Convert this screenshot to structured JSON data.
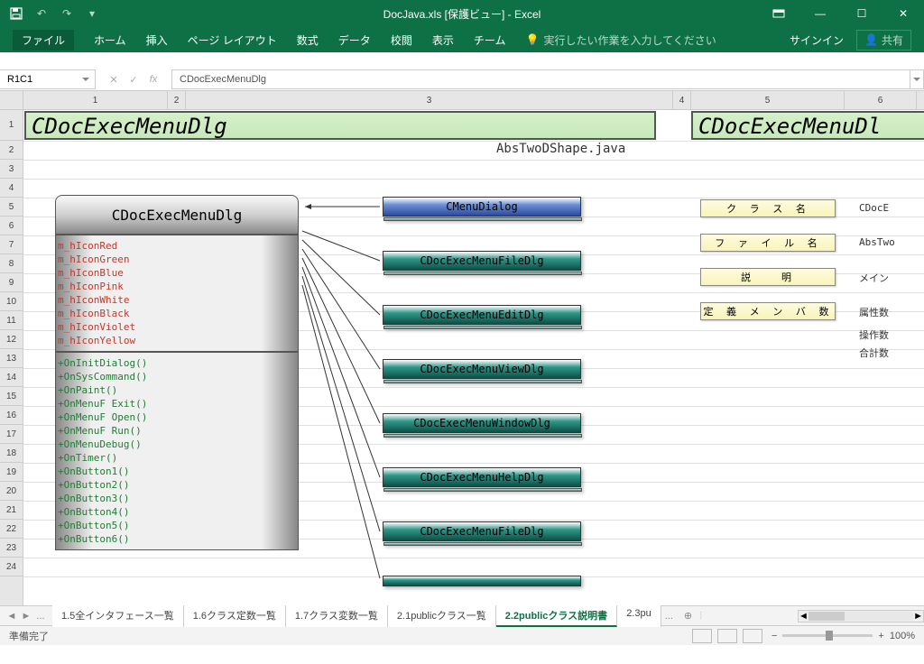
{
  "title": "DocJava.xls  [保護ビュー] - Excel",
  "ribbon": {
    "file": "ファイル",
    "home": "ホーム",
    "insert": "挿入",
    "layout": "ページ レイアウト",
    "formula": "数式",
    "data": "データ",
    "review": "校閲",
    "view": "表示",
    "team": "チーム",
    "tellme": "実行したい作業を入力してください",
    "signin": "サインイン",
    "share": "共有"
  },
  "namebox": "R1C1",
  "formula": "CDocExecMenuDlg",
  "colheads": [
    "1",
    "2",
    "3",
    "4",
    "5",
    "6"
  ],
  "rowheads": [
    "1",
    "2",
    "3",
    "4",
    "5",
    "6",
    "7",
    "8",
    "9",
    "10",
    "11",
    "12",
    "13",
    "14",
    "15",
    "16",
    "17",
    "18",
    "19",
    "20",
    "21",
    "22",
    "23",
    "24"
  ],
  "banner1": "CDocExecMenuDlg",
  "banner2": "CDocExecMenuDl",
  "filelabel": "AbsTwoDShape.java",
  "classname": "CDocExecMenuDlg",
  "attrs": [
    "m_hIconRed",
    "m_hIconGreen",
    "m_hIconBlue",
    "m_hIconPink",
    "m_hIconWhite",
    "m_hIconBlack",
    "m_hIconViolet",
    "m_hIconYellow"
  ],
  "methods": [
    "+OnInitDialog()",
    "+OnSysCommand()",
    "+OnPaint()",
    "+OnMenuF Exit()",
    "+OnMenuF Open()",
    "+OnMenuF Run()",
    "+OnMenuDebug()",
    "+OnTimer()",
    "+OnButton1()",
    "+OnButton2()",
    "+OnButton3()",
    "+OnButton4()",
    "+OnButton5()",
    "+OnButton6()"
  ],
  "relboxes": [
    "CMenuDialog",
    "CDocExecMenuFileDlg",
    "CDocExecMenuEditDlg",
    "CDocExecMenuViewDlg",
    "CDocExecMenuWindowDlg",
    "CDocExecMenuHelpDlg",
    "CDocExecMenuFileDlg"
  ],
  "props": [
    {
      "label": "ク ラ ス 名",
      "val": "CDocE"
    },
    {
      "label": "フ ァ イ ル 名",
      "val": "AbsTwo"
    },
    {
      "label": "説　　明",
      "val": "メイン"
    },
    {
      "label": "定 義 メ ン バ 数",
      "val": "属性数"
    }
  ],
  "extravals": [
    "操作数",
    "合計数"
  ],
  "tabs": [
    "1.5全インタフェース一覧",
    "1.6クラス定数一覧",
    "1.7クラス変数一覧",
    "2.1publicクラス一覧",
    "2.2publicクラス説明書",
    "2.3pu"
  ],
  "activeTab": "2.2publicクラス説明書",
  "tabmore": "...",
  "status": "準備完了",
  "zoom": "100%"
}
